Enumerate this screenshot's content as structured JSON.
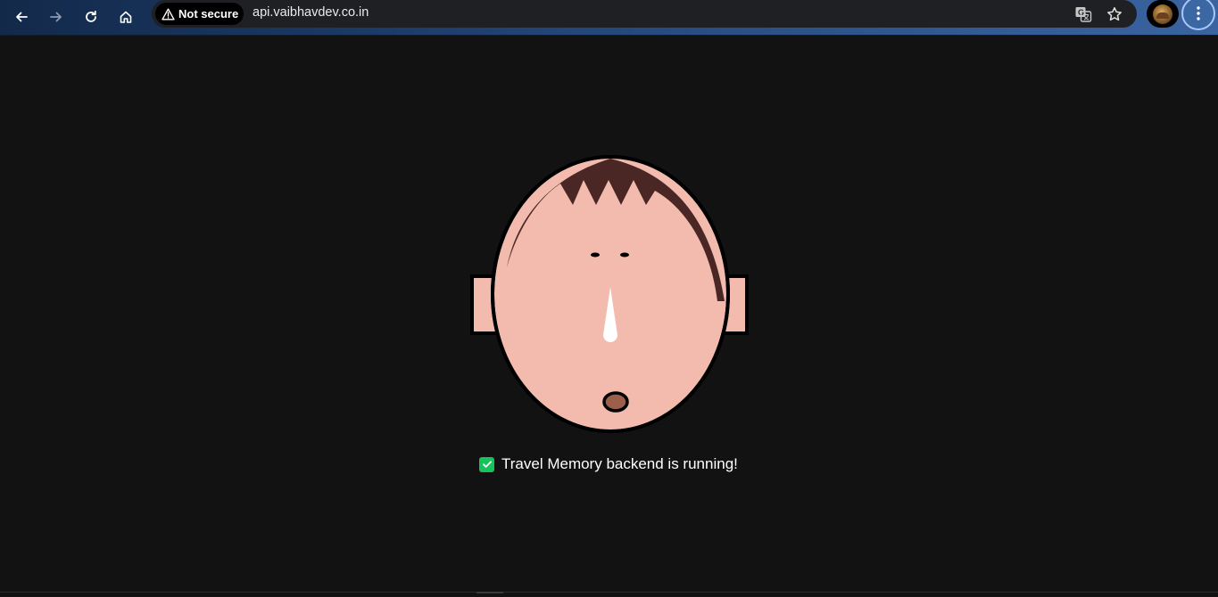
{
  "browser": {
    "security_label": "Not secure",
    "url": "api.vaibhavdev.co.in",
    "icons": {
      "back": "arrow-left-icon",
      "forward": "arrow-right-icon",
      "reload": "reload-icon",
      "home": "home-icon",
      "warning": "warning-triangle-icon",
      "translate": "translate-icon",
      "bookmark": "star-icon",
      "menu": "kebab-menu-icon"
    },
    "colors": {
      "accent": "#a8c7fa",
      "omnibox": "#1f2023"
    }
  },
  "page": {
    "background": "#121212",
    "status_message": "Travel Memory backend is running!",
    "status_icon": "check-box-icon",
    "status_color": "#16c35b",
    "illustration": {
      "skin": "#f2bbad",
      "hair": "#4a2724",
      "nose": "#ffffff",
      "mouth": "#9c5f4c"
    }
  }
}
